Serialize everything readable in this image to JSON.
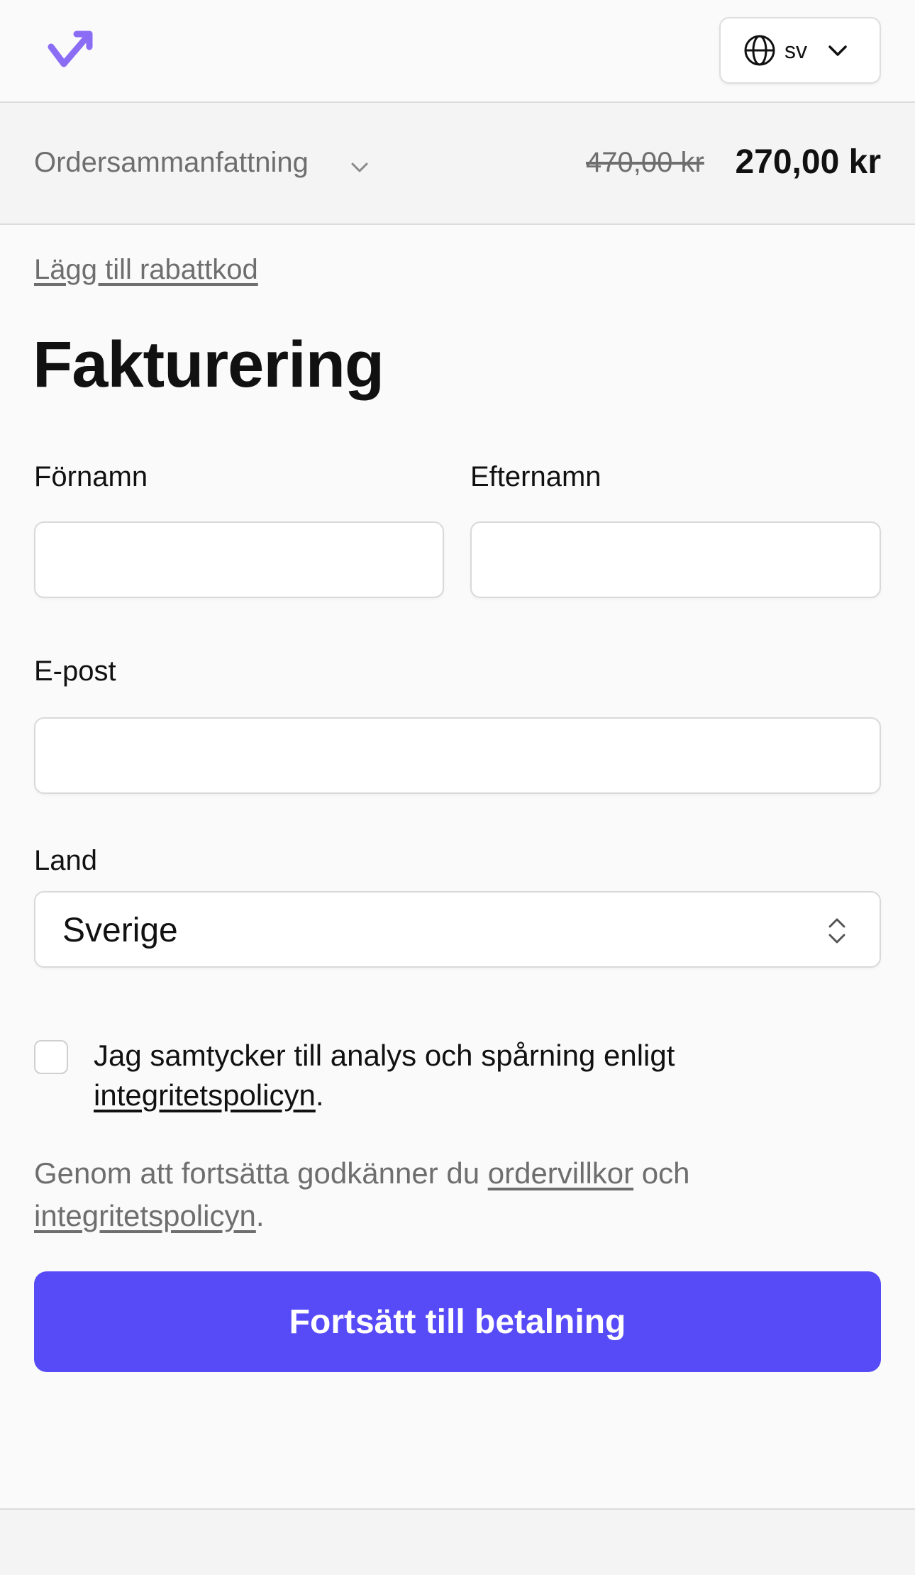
{
  "header": {
    "logo_icon": "checkmark-arrow-logo",
    "language": {
      "icon": "globe-icon",
      "code": "sv",
      "chevron": "chevron-down-icon"
    }
  },
  "summary": {
    "label": "Ordersammanfattning",
    "old_price": "470,00 kr",
    "new_price": "270,00 kr"
  },
  "discount_link": "Lägg till rabattkod",
  "form": {
    "title": "Fakturering",
    "first_name_label": "Förnamn",
    "first_name_value": "",
    "last_name_label": "Efternamn",
    "last_name_value": "",
    "email_label": "E-post",
    "email_value": "",
    "country_label": "Land",
    "country_value": "Sverige"
  },
  "consent": {
    "checked": false,
    "text": "Jag samtycker till analys och spårning enligt",
    "link": "integritetspolicyn",
    "suffix": "."
  },
  "terms": {
    "prefix": "Genom att fortsätta godkänner du",
    "terms_link": "ordervillkor",
    "middle": "och",
    "privacy_link": "integritetspolicyn",
    "suffix": "."
  },
  "cta_label": "Fortsätt till betalning",
  "colors": {
    "accent": "#574bf7",
    "logo": "#8b6cf5",
    "muted_text": "#6e6e6e"
  }
}
